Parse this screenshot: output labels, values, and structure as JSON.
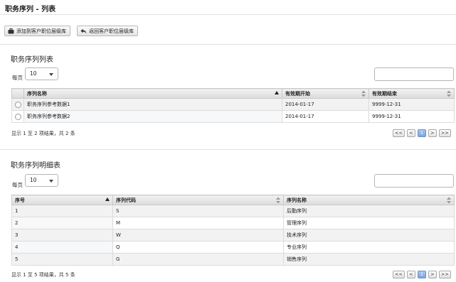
{
  "page": {
    "title": "职务序列 - 列表"
  },
  "toolbar": {
    "add_label": "添加到客户职位层级库",
    "back_label": "返回客户职位层级库"
  },
  "section1": {
    "title": "职务序列列表",
    "per_page_label": "每页",
    "per_page_value": "10",
    "columns": [
      "",
      "序列名称",
      "有效期开始",
      "有效期结束"
    ],
    "rows": [
      {
        "name": "职务序列参考数据1",
        "start": "2014-01-17",
        "end": "9999-12-31",
        "highlight": true
      },
      {
        "name": "职务序列参考数据2",
        "start": "2014-01-17",
        "end": "9999-12-31",
        "highlight": false
      }
    ],
    "info": "显示 1 至 2 项结果，共 2 条",
    "pager": {
      "first": "<<",
      "prev": "<",
      "current": "1",
      "next": ">",
      "last": ">>"
    }
  },
  "section2": {
    "title": "职务序列明细表",
    "per_page_label": "每页",
    "per_page_value": "10",
    "columns": [
      "序号",
      "序列代码",
      "序列名称"
    ],
    "rows": [
      {
        "no": "1",
        "code": "S",
        "name": "后勤序列"
      },
      {
        "no": "2",
        "code": "M",
        "name": "管理序列"
      },
      {
        "no": "3",
        "code": "W",
        "name": "技术序列"
      },
      {
        "no": "4",
        "code": "Q",
        "name": "专业序列"
      },
      {
        "no": "5",
        "code": "G",
        "name": "销售序列"
      }
    ],
    "info": "显示 1 至 5 项结果，共 5 条",
    "pager": {
      "first": "<<",
      "prev": "<",
      "current": "1",
      "next": ">",
      "last": ">>"
    }
  },
  "colors": {
    "highlight_text": "#e02020",
    "pager_active": "#7aa4dd"
  }
}
